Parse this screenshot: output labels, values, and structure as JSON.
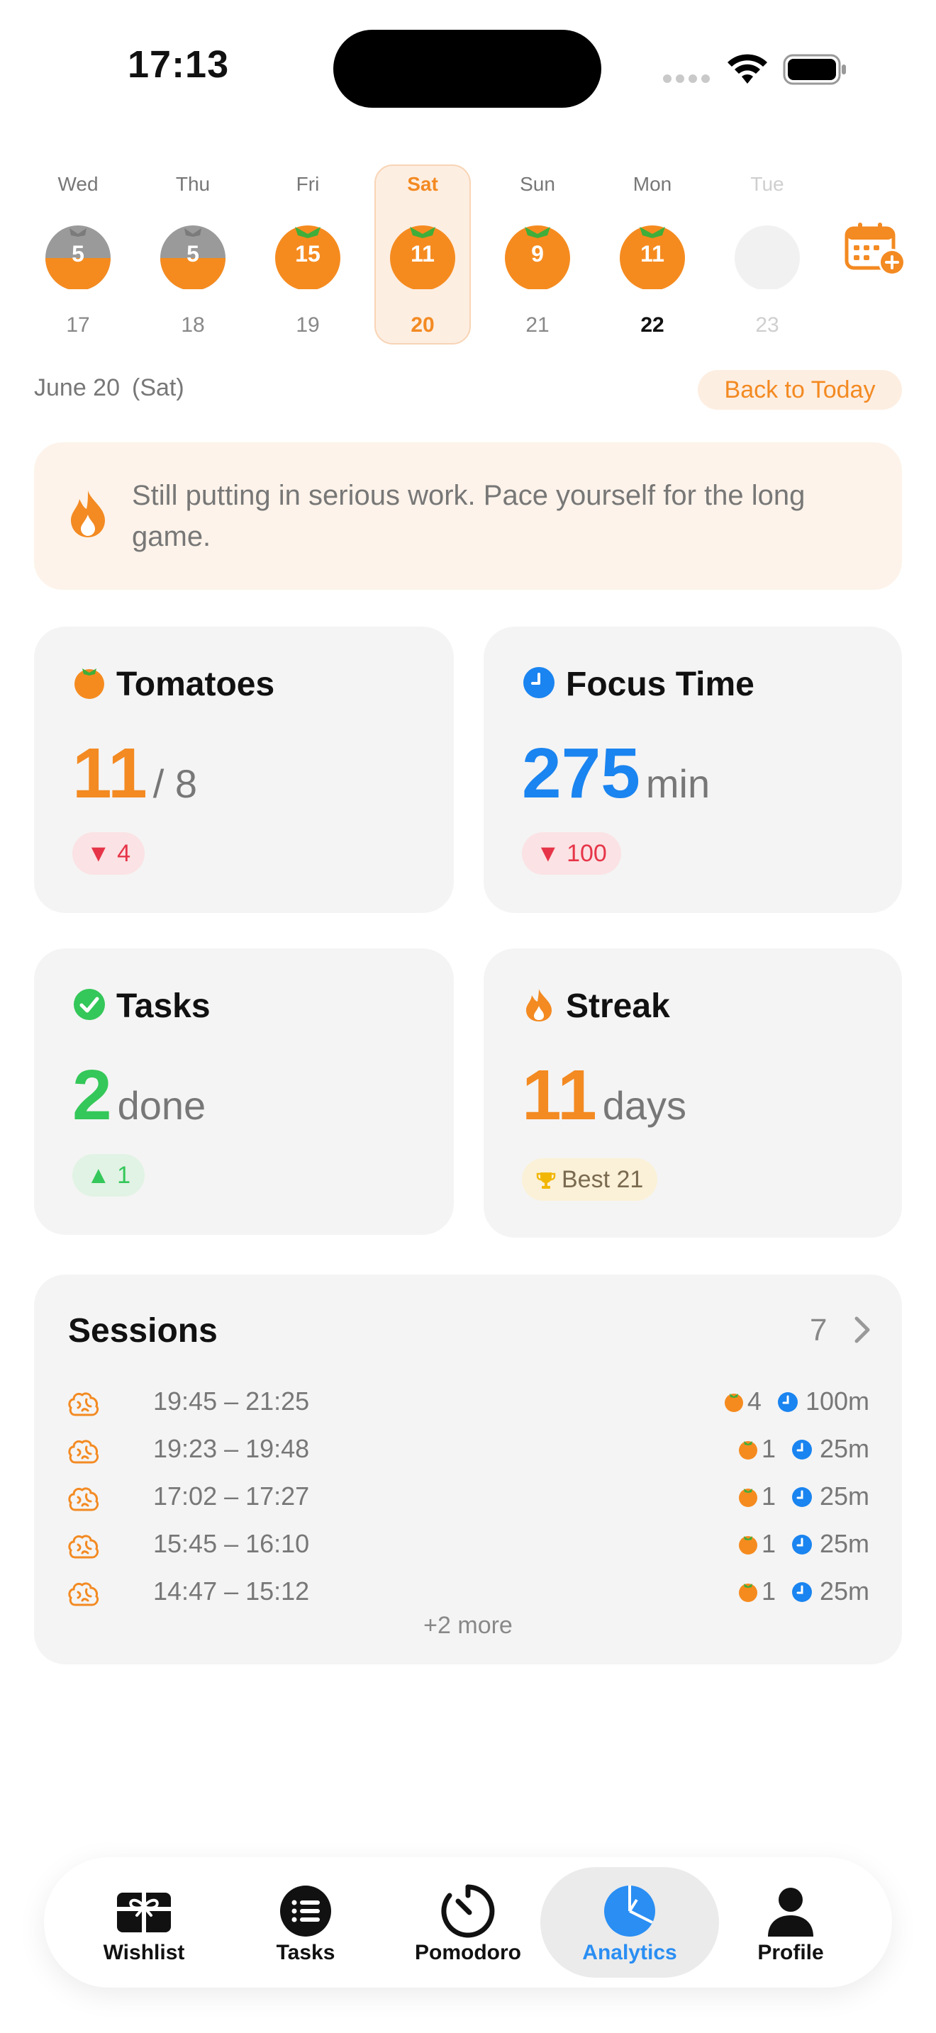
{
  "status_bar": {
    "time": "17:13"
  },
  "week": [
    {
      "day": "Wed",
      "date": "17",
      "count": "5",
      "state": "past-partial"
    },
    {
      "day": "Thu",
      "date": "18",
      "count": "5",
      "state": "past-partial"
    },
    {
      "day": "Fri",
      "date": "19",
      "count": "15",
      "state": "done"
    },
    {
      "day": "Sat",
      "date": "20",
      "count": "11",
      "state": "selected"
    },
    {
      "day": "Sun",
      "date": "21",
      "count": "9",
      "state": "done"
    },
    {
      "day": "Mon",
      "date": "22",
      "count": "11",
      "state": "today"
    },
    {
      "day": "Tue",
      "date": "23",
      "count": "",
      "state": "future"
    }
  ],
  "header": {
    "date_label": "June 20 (Sat)",
    "back_to_today": "Back to Today"
  },
  "banner": {
    "text": "Still putting in serious work. Pace yourself for the long game.",
    "icon": "flame-icon"
  },
  "stats": {
    "tomatoes": {
      "title": "Tomatoes",
      "value": "11",
      "unit": "/ 8",
      "delta": "▼ 4",
      "icon": "tomato-icon"
    },
    "focus": {
      "title": "Focus Time",
      "value": "275",
      "unit": "min",
      "delta": "▼ 100",
      "icon": "clock-icon"
    },
    "tasks": {
      "title": "Tasks",
      "value": "2",
      "unit": "done",
      "delta": "▲ 1",
      "icon": "checkmark-icon"
    },
    "streak": {
      "title": "Streak",
      "value": "11",
      "unit": "days",
      "best": "Best 21",
      "icon": "flame-icon"
    }
  },
  "sessions": {
    "title": "Sessions",
    "count": "7",
    "more": "+2 more",
    "rows": [
      {
        "time": "19:45 – 21:25",
        "tomatoes": "4",
        "minutes": "100m"
      },
      {
        "time": "19:23 – 19:48",
        "tomatoes": "1",
        "minutes": "25m"
      },
      {
        "time": "17:02 – 17:27",
        "tomatoes": "1",
        "minutes": "25m"
      },
      {
        "time": "15:45 – 16:10",
        "tomatoes": "1",
        "minutes": "25m"
      },
      {
        "time": "14:47 – 15:12",
        "tomatoes": "1",
        "minutes": "25m"
      }
    ]
  },
  "tabs": [
    {
      "label": "Wishlist",
      "icon": "gift-icon"
    },
    {
      "label": "Tasks",
      "icon": "list-icon"
    },
    {
      "label": "Pomodoro",
      "icon": "timer-icon"
    },
    {
      "label": "Analytics",
      "icon": "pie-chart-icon",
      "active": true
    },
    {
      "label": "Profile",
      "icon": "person-icon"
    }
  ],
  "colors": {
    "accent": "#f38a22",
    "blue": "#1a84f0",
    "green": "#34c759",
    "red": "#e63548",
    "tab_active": "#2a8ef3"
  }
}
